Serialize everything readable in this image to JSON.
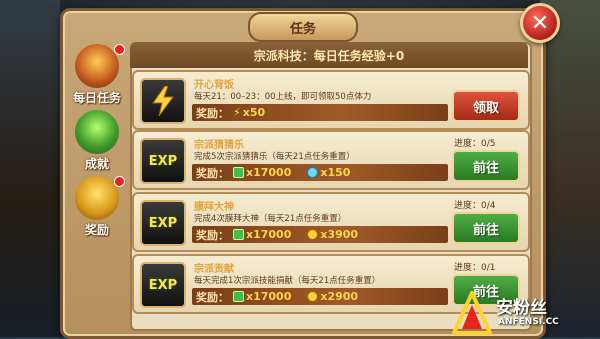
{
  "window": {
    "title": "任务"
  },
  "header": {
    "text": "宗派科技：每日任务经验+0"
  },
  "sidebar": {
    "items": [
      {
        "label": "每日任务",
        "icon": "daily-task-icon",
        "badge": true
      },
      {
        "label": "成就",
        "icon": "achievement-icon",
        "badge": false
      },
      {
        "label": "奖励",
        "icon": "reward-icon",
        "badge": true
      }
    ]
  },
  "tasks": [
    {
      "name": "开心背饭",
      "desc": "每天21：00–23：00上线，即可领取50点体力",
      "reward_label": "奖励：",
      "rewards": [
        {
          "icon": "energy-icon",
          "amount": "x50"
        }
      ],
      "progress": "",
      "button": "领取",
      "icon": "lightning-icon"
    },
    {
      "name": "宗派猜猜乐",
      "desc": "完成5次宗派猜猜乐（每天21点任务重置）",
      "reward_label": "奖励：",
      "rewards": [
        {
          "icon": "exp-gem-icon",
          "amount": "x17000"
        },
        {
          "icon": "orb-icon",
          "amount": "x150"
        }
      ],
      "progress": "进度：0/5",
      "button": "前往",
      "icon": "exp-icon"
    },
    {
      "name": "膜拜大神",
      "desc": "完成4次膜拜大神（每天21点任务重置）",
      "reward_label": "奖励：",
      "rewards": [
        {
          "icon": "exp-gem-icon",
          "amount": "x17000"
        },
        {
          "icon": "coin-icon",
          "amount": "x3900"
        }
      ],
      "progress": "进度：0/4",
      "button": "前往",
      "icon": "exp-icon"
    },
    {
      "name": "宗派贡献",
      "desc": "每天完成1次宗派技能捐献（每天21点任务重置）",
      "reward_label": "奖励：",
      "rewards": [
        {
          "icon": "exp-gem-icon",
          "amount": "x17000"
        },
        {
          "icon": "coin-icon",
          "amount": "x2900"
        }
      ],
      "progress": "进度：0/1",
      "button": "前往",
      "icon": "exp-icon"
    }
  ],
  "exp_text": "EXP",
  "watermark": {
    "name": "安粉丝",
    "url": "ANFENSI.CC"
  },
  "close_label": "✕",
  "colors": {
    "accent_gold": "#e3a33b",
    "claim_button": "#c23a24",
    "go_button": "#3a9331"
  }
}
